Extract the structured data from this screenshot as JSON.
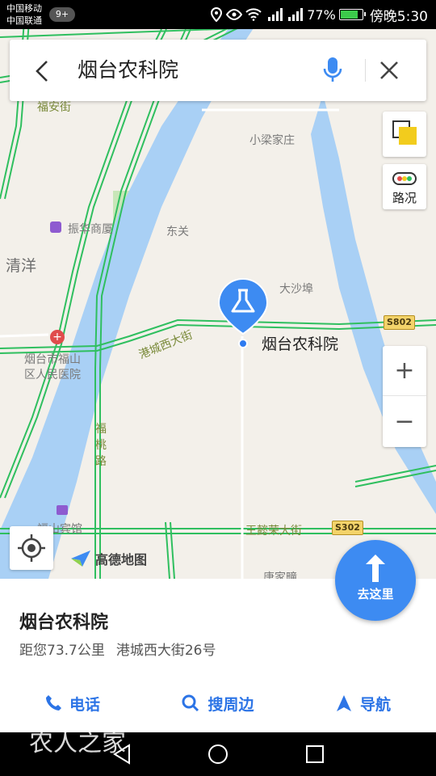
{
  "status_bar": {
    "carrier_1": "中国移动",
    "carrier_2": "中国联通",
    "notification_count": "9+",
    "battery": "77%",
    "time": "傍晚5:30"
  },
  "search": {
    "query": "烟台农科院"
  },
  "map": {
    "labels": {
      "xiaoliang": "小梁家庄",
      "zhenhua": "振华商厦",
      "dongguan": "东关",
      "qingyang": "清洋",
      "dashabu": "大沙埠",
      "hospital_1": "烟台市福山",
      "hospital_2": "区人民医院",
      "gangcheng": "港城西大街",
      "fushan_hotel": "福山宾馆",
      "fuan": "福安街",
      "fulu_1": "福",
      "fulu_2": "桃",
      "fulu_3": "路",
      "wangyirong": "王懿荣大街",
      "tangjia": "唐家疃"
    },
    "shields": {
      "s802": "S802",
      "s302": "S302"
    },
    "poi_label": "烟台农科院",
    "traffic_label": "路况",
    "zoom_in": "+",
    "zoom_out": "−",
    "logo_text": "高德地图",
    "colors": {
      "road_green": "#2fbf5f",
      "river": "#a9d0f5",
      "land": "#f3f0ea",
      "accent": "#3d8bf2"
    }
  },
  "place": {
    "title": "烟台农科院",
    "distance": "距您73.7公里",
    "address": "港城西大街26号"
  },
  "actions": {
    "phone": "电话",
    "nearby": "搜周边",
    "navigate": "导航",
    "go_here": "去这里"
  },
  "watermark": "农人之家"
}
